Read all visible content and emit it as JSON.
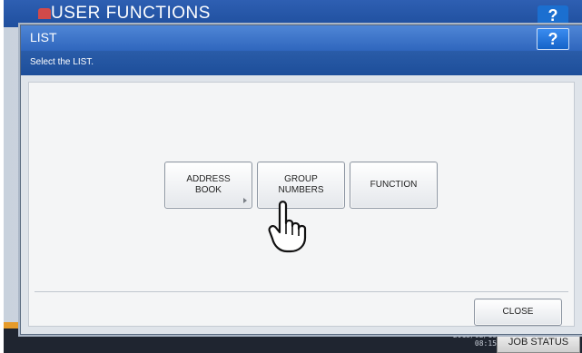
{
  "background": {
    "title": "USER FUNCTIONS",
    "help_label": "?",
    "datetime_line1": "2013/02/10",
    "datetime_line2": "08:15",
    "job_status_label": "JOB STATUS"
  },
  "dialog": {
    "title": "LIST",
    "help_label": "?",
    "message": "Select the LIST.",
    "buttons": {
      "address_book": "ADDRESS\nBOOK",
      "group_numbers": "GROUP\nNUMBERS",
      "function": "FUNCTION"
    },
    "close_label": "CLOSE"
  },
  "colors": {
    "title_bar": "#2f66bd",
    "message_bar": "#1d4e9a",
    "help_button": "#1463c8",
    "dialog_bg": "#f4f5f6"
  },
  "icons": [
    "pointing-hand-icon",
    "chevron-right-icon",
    "printer-icon"
  ]
}
